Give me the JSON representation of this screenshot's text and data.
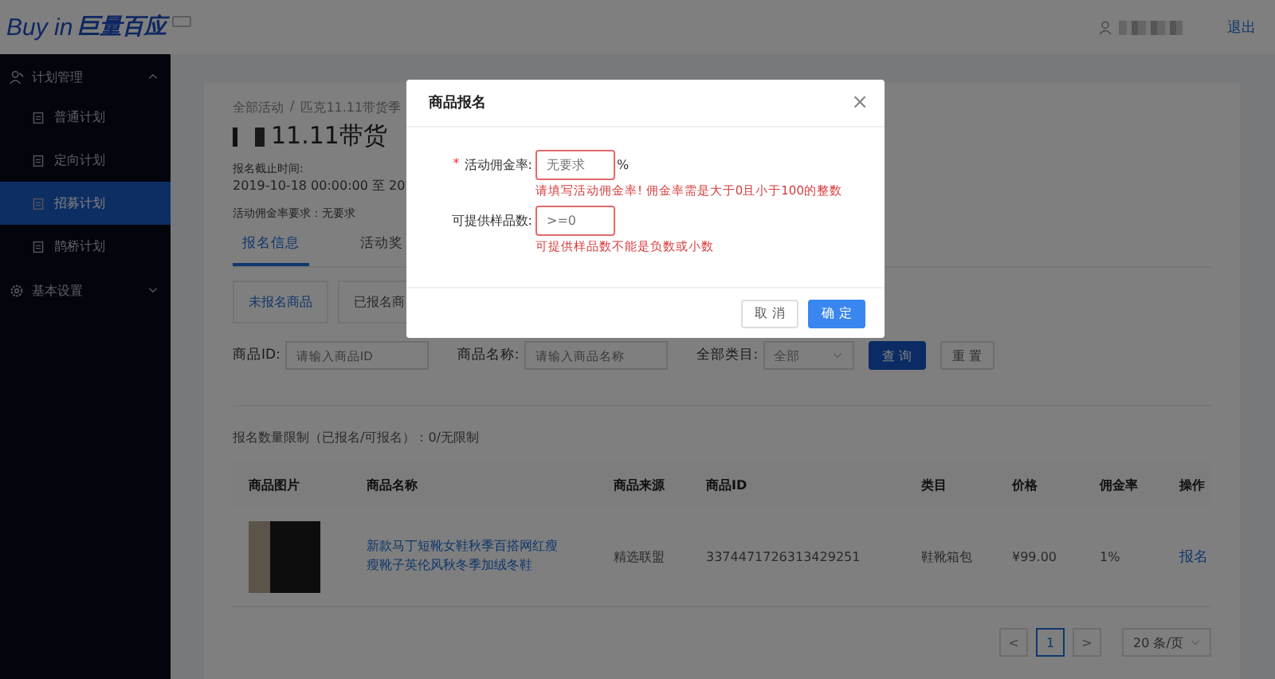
{
  "header": {
    "logo_text": "Buy in",
    "logo_cn": "巨量百应",
    "logout": "退出"
  },
  "sidebar": {
    "items": [
      {
        "label": "计划管理",
        "expanded": true,
        "children": [
          {
            "label": "普通计划",
            "selected": false
          },
          {
            "label": "定向计划",
            "selected": false
          },
          {
            "label": "招募计划",
            "selected": true
          },
          {
            "label": "鹊桥计划",
            "selected": false
          }
        ]
      },
      {
        "label": "基本设置",
        "expanded": false
      }
    ]
  },
  "content": {
    "breadcrumb": [
      "全部活动",
      "匹克11.11带货季"
    ],
    "breadcrumb_separator": "/",
    "title": "11.11带货",
    "deadline_label": "报名截止时间:",
    "deadline_value": "2019-10-18 00:00:00 至 20",
    "commission_requirement": "活动佣金率要求：无要求",
    "tabs": [
      {
        "label": "报名信息",
        "selected": true
      },
      {
        "label": "活动奖",
        "selected": false
      }
    ],
    "subtabs": [
      {
        "label": "未报名商品",
        "selected": true
      },
      {
        "label": "已报名商",
        "selected": false
      }
    ],
    "filters": [
      {
        "kind": "input",
        "label": "商品ID:",
        "placeholder": "请输入商品ID"
      },
      {
        "kind": "input",
        "label": "商品名称:",
        "placeholder": "请输入商品名称"
      },
      {
        "kind": "select",
        "label": "全部类目:",
        "value": "全部"
      }
    ],
    "query_button": "查 询",
    "reset_button": "重 置",
    "quota": "报名数量限制（已报名/可报名）：0/无限制",
    "table": {
      "columns": [
        "商品图片",
        "商品名称",
        "商品来源",
        "商品ID",
        "类目",
        "价格",
        "佣金率",
        "操作"
      ],
      "rows": [
        {
          "name": "新款马丁短靴女鞋秋季百搭网红瘦瘦靴子英伦风秋冬季加绒冬鞋",
          "source": "精选联盟",
          "id": "3374471726313429251",
          "category": "鞋靴箱包",
          "price": "¥99.00",
          "commission": "1%",
          "action": "报名"
        }
      ]
    },
    "pagination": {
      "prev": "<",
      "pages": [
        {
          "label": "1",
          "selected": true
        }
      ],
      "next": ">",
      "page_size": "20 条/页"
    }
  },
  "modal": {
    "title": "商品报名",
    "close": "×",
    "fields": [
      {
        "label": "活动佣金率:",
        "required_mark": "*",
        "placeholder": "无要求",
        "suffix": "%",
        "error": "请填写活动佣金率! 佣金率需是大于0且小于100的整数"
      },
      {
        "label": "可提供样品数:",
        "placeholder": ">=0",
        "error": "可提供样品数不能是负数或小数"
      }
    ],
    "cancel": "取 消",
    "ok": "确 定"
  }
}
